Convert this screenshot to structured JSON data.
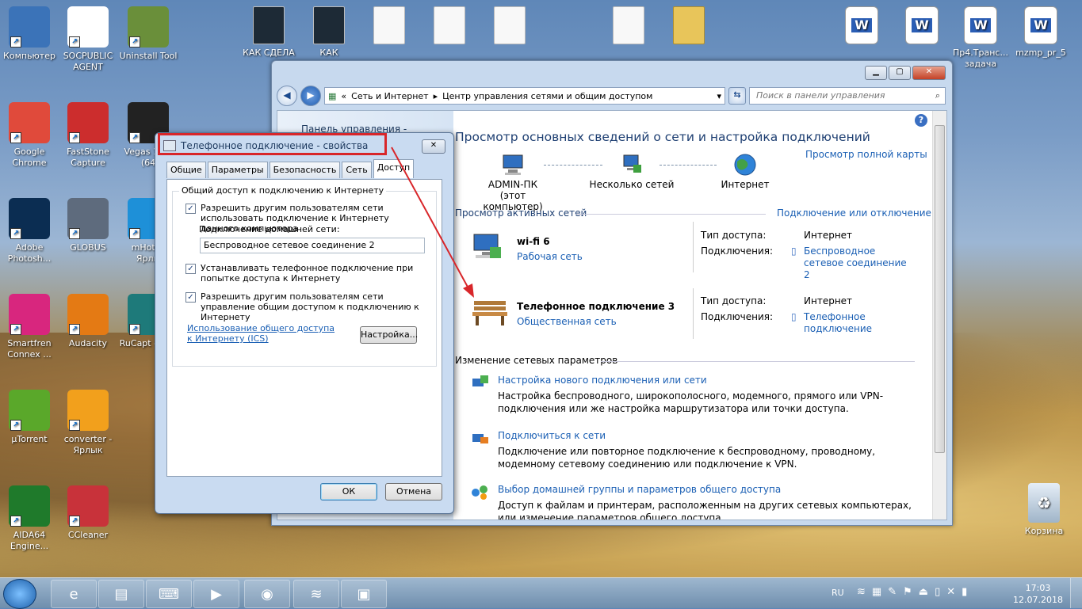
{
  "desktop": {
    "icons_col1": [
      {
        "label": "Компьютер",
        "icon": "computer-icon",
        "color": "#3b73b8"
      },
      {
        "label": "Google Chrome",
        "icon": "chrome-icon",
        "color": "#e04a3b"
      },
      {
        "label": "Adobe Photosh...",
        "icon": "photoshop-icon",
        "color": "#0b2d52"
      },
      {
        "label": "Smartfren Connex ...",
        "icon": "smartfren-icon",
        "color": "#d8267e"
      },
      {
        "label": "µTorrent",
        "icon": "utorrent-icon",
        "color": "#5aa82a"
      },
      {
        "label": "AIDA64 Engine...",
        "icon": "aida64-icon",
        "color": "#1f7a2b"
      }
    ],
    "icons_col2": [
      {
        "label": "SOCPUBLIC AGENT",
        "icon": "socpublic-icon",
        "color": "#ffffff"
      },
      {
        "label": "FastStone Capture",
        "icon": "faststone-icon",
        "color": "#cc2d2d"
      },
      {
        "label": "GLOBUS",
        "icon": "globus-icon",
        "color": "#5e6b7d"
      },
      {
        "label": "Audacity",
        "icon": "audacity-icon",
        "color": "#e47a14"
      },
      {
        "label": "converter - Ярлык",
        "icon": "converter-icon",
        "color": "#f2a01c"
      },
      {
        "label": "CCleaner",
        "icon": "ccleaner-icon",
        "color": "#c8323a"
      }
    ],
    "icons_col3": [
      {
        "label": "Uninstall Tool",
        "icon": "uninstall-tool-icon",
        "color": "#6a8f3a"
      },
      {
        "label": "Vegas 14.0 (64",
        "icon": "vegas-icon",
        "color": "#222222"
      },
      {
        "label": "mHotsp Ярлы",
        "icon": "wifi-hotspot-icon",
        "color": "#1e90d8"
      },
      {
        "label": "RuCapt - Ярл",
        "icon": "rucaptcha-icon",
        "color": "#1e7a7a"
      }
    ],
    "top_files": [
      {
        "label": "КАК СДЕЛА",
        "icon": "video-icon"
      },
      {
        "label": "КАК",
        "icon": "youtube-icon"
      },
      {
        "label": "",
        "icon": "document-icon"
      },
      {
        "label": "",
        "icon": "document-icon"
      },
      {
        "label": "",
        "icon": "document-icon"
      },
      {
        "label": "",
        "icon": "document-icon"
      },
      {
        "label": "",
        "icon": "folder-icon"
      }
    ],
    "word_files": [
      {
        "label": "",
        "icon": "word-document-icon"
      },
      {
        "label": "",
        "icon": "word-document-icon"
      },
      {
        "label": "Пр4.Транс... задача",
        "icon": "word-document-icon"
      },
      {
        "label": "mzmp_pr_5",
        "icon": "word-document-icon"
      }
    ],
    "recycle_bin": {
      "label": "Корзина",
      "icon": "recycle-bin-icon"
    }
  },
  "explorer": {
    "address": {
      "segments": [
        "Сеть и Интернет",
        "Центр управления сетями и общим доступом"
      ]
    },
    "search_placeholder": "Поиск в панели управления",
    "left_pane_title": "Панель управления -",
    "heading": "Просмотр основных сведений о сети и настройка подключений",
    "full_map_link": "Просмотр полной карты",
    "map": {
      "node1": {
        "name": "ADMIN-ПК",
        "sub": "(этот компьютер)"
      },
      "node2": {
        "name": "Несколько сетей"
      },
      "node3": {
        "name": "Интернет"
      }
    },
    "active_networks_label": "Просмотр активных сетей",
    "connect_disconnect_link": "Подключение или отключение",
    "networks": [
      {
        "name": "wi-fi 6",
        "type": "Рабочая сеть",
        "access_label": "Тип доступа:",
        "access_value": "Интернет",
        "conn_label": "Подключения:",
        "conn_value": "Беспроводное сетевое соединение 2"
      },
      {
        "name": "Телефонное подключение 3",
        "type": "Общественная сеть",
        "access_label": "Тип доступа:",
        "access_value": "Интернет",
        "conn_label": "Подключения:",
        "conn_value": "Телефонное подключение"
      }
    ],
    "change_settings_label": "Изменение сетевых параметров",
    "tasks": [
      {
        "title": "Настройка нового подключения или сети",
        "desc": "Настройка беспроводного, широкополосного, модемного, прямого или VPN-подключения или же настройка маршрутизатора или точки доступа."
      },
      {
        "title": "Подключиться к сети",
        "desc": "Подключение или повторное подключение к беспроводному, проводному, модемному сетевому соединению или подключение к VPN."
      },
      {
        "title": "Выбор домашней группы и параметров общего доступа",
        "desc": "Доступ к файлам и принтерам, расположенным на других сетевых компьютерах, или изменение параметров общего доступа."
      }
    ]
  },
  "dialog": {
    "title": "Телефонное подключение - свойства",
    "tabs": [
      "Общие",
      "Параметры",
      "Безопасность",
      "Сеть",
      "Доступ"
    ],
    "active_tab": "Доступ",
    "group_label": "Общий доступ к подключению к Интернету",
    "cb1": "Разрешить другим пользователям сети использовать подключение к Интернету данного компьютера",
    "home_net_label": "Подключение домашней сети:",
    "home_net_value": "Беспроводное сетевое соединение 2",
    "cb2": "Устанавливать телефонное подключение при попытке доступа к Интернету",
    "cb3": "Разрешить другим пользователям сети управление общим доступом к подключению к Интернету",
    "ics_link": "Использование общего доступа к Интернету (ICS)",
    "settings_btn": "Настройка...",
    "ok_btn": "ОК",
    "cancel_btn": "Отмена",
    "checkbox_states": [
      true,
      true,
      true
    ]
  },
  "taskbar": {
    "items": [
      "ie-icon",
      "explorer-icon",
      "keyboard-icon",
      "media-player-icon",
      "chrome-icon",
      "wifi-icon",
      "network-manager-icon"
    ],
    "lang": "RU",
    "time": "17:03",
    "date": "12.07.2018"
  },
  "colors": {
    "highlight": "#d8262a",
    "link": "#1a5fb4",
    "heading": "#1e3f72"
  }
}
